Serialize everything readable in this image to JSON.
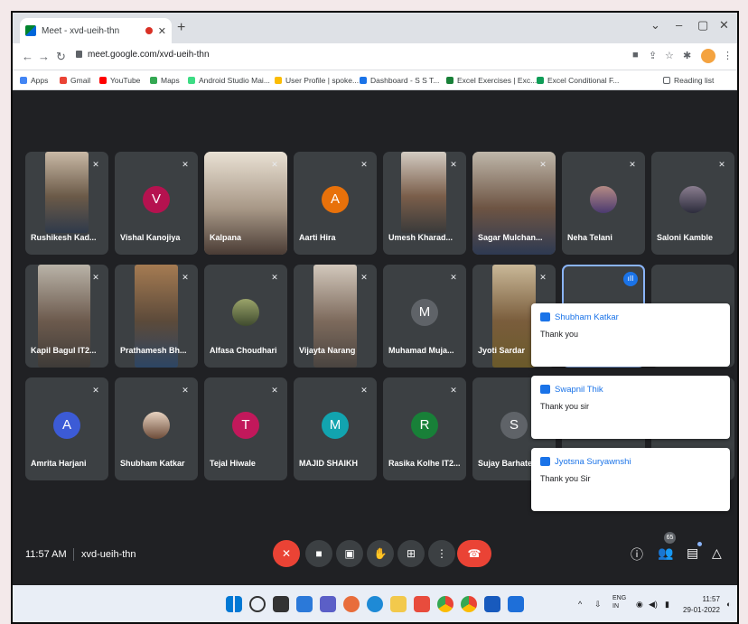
{
  "browser": {
    "tab_title": "Meet - xvd-ueih-thn",
    "url": "meet.google.com/xvd-ueih-thn",
    "bookmarks": [
      "Apps",
      "Gmail",
      "YouTube",
      "Maps",
      "Android Studio Mai...",
      "User Profile | spoke...",
      "Dashboard - S S T...",
      "Excel Exercises | Exc...",
      "Excel Conditional F..."
    ],
    "reading_list": "Reading list"
  },
  "participants": [
    {
      "name": "Rushikesh Kad...",
      "type": "photo"
    },
    {
      "name": "Vishal Kanojiya",
      "type": "avatar",
      "initial": "V",
      "color": "#b5124f"
    },
    {
      "name": "Kalpana",
      "type": "photo"
    },
    {
      "name": "Aarti Hira",
      "type": "avatar",
      "initial": "A",
      "color": "#e8710a"
    },
    {
      "name": "Umesh Kharad...",
      "type": "photo"
    },
    {
      "name": "Sagar Mulchan...",
      "type": "photo"
    },
    {
      "name": "Neha Telani",
      "type": "photo"
    },
    {
      "name": "Saloni Kamble",
      "type": "photo"
    },
    {
      "name": "Kapil Bagul IT2...",
      "type": "photo"
    },
    {
      "name": "Prathamesh Bh...",
      "type": "photo"
    },
    {
      "name": "Alfasa Choudhari",
      "type": "photo"
    },
    {
      "name": "Vijayta Narang",
      "type": "photo"
    },
    {
      "name": "Muhamad Muja...",
      "type": "avatar",
      "initial": "M",
      "color": "#5f6368"
    },
    {
      "name": "Jyoti Sardar",
      "type": "photo"
    },
    {
      "name": "Amrita Harjani",
      "type": "avatar",
      "initial": "A",
      "color": "#3c5bd6"
    },
    {
      "name": "Shubham Katkar",
      "type": "photo"
    },
    {
      "name": "Tejal Hiwale",
      "type": "avatar",
      "initial": "T",
      "color": "#c2185b"
    },
    {
      "name": "MAJID SHAIKH",
      "type": "avatar",
      "initial": "M",
      "color": "#12a4af"
    },
    {
      "name": "Rasika Kolhe IT2...",
      "type": "avatar",
      "initial": "R",
      "color": "#188038"
    },
    {
      "name": "Sujay Barhate",
      "type": "avatar",
      "initial": "S",
      "color": "#5f6368"
    }
  ],
  "messages": [
    {
      "sender": "Shubham Katkar",
      "text": "Thank you"
    },
    {
      "sender": "Swapnil Thik",
      "text": "Thank you sir"
    },
    {
      "sender": "Jyotsna Suryawnshi",
      "text": "Thank you Sir"
    }
  ],
  "meeting": {
    "time": "11:57 AM",
    "code": "xvd-ueih-thn",
    "participant_count": "65"
  },
  "taskbar": {
    "lang": "ENG",
    "region": "IN",
    "time": "11:57",
    "date": "29-01-2022"
  }
}
